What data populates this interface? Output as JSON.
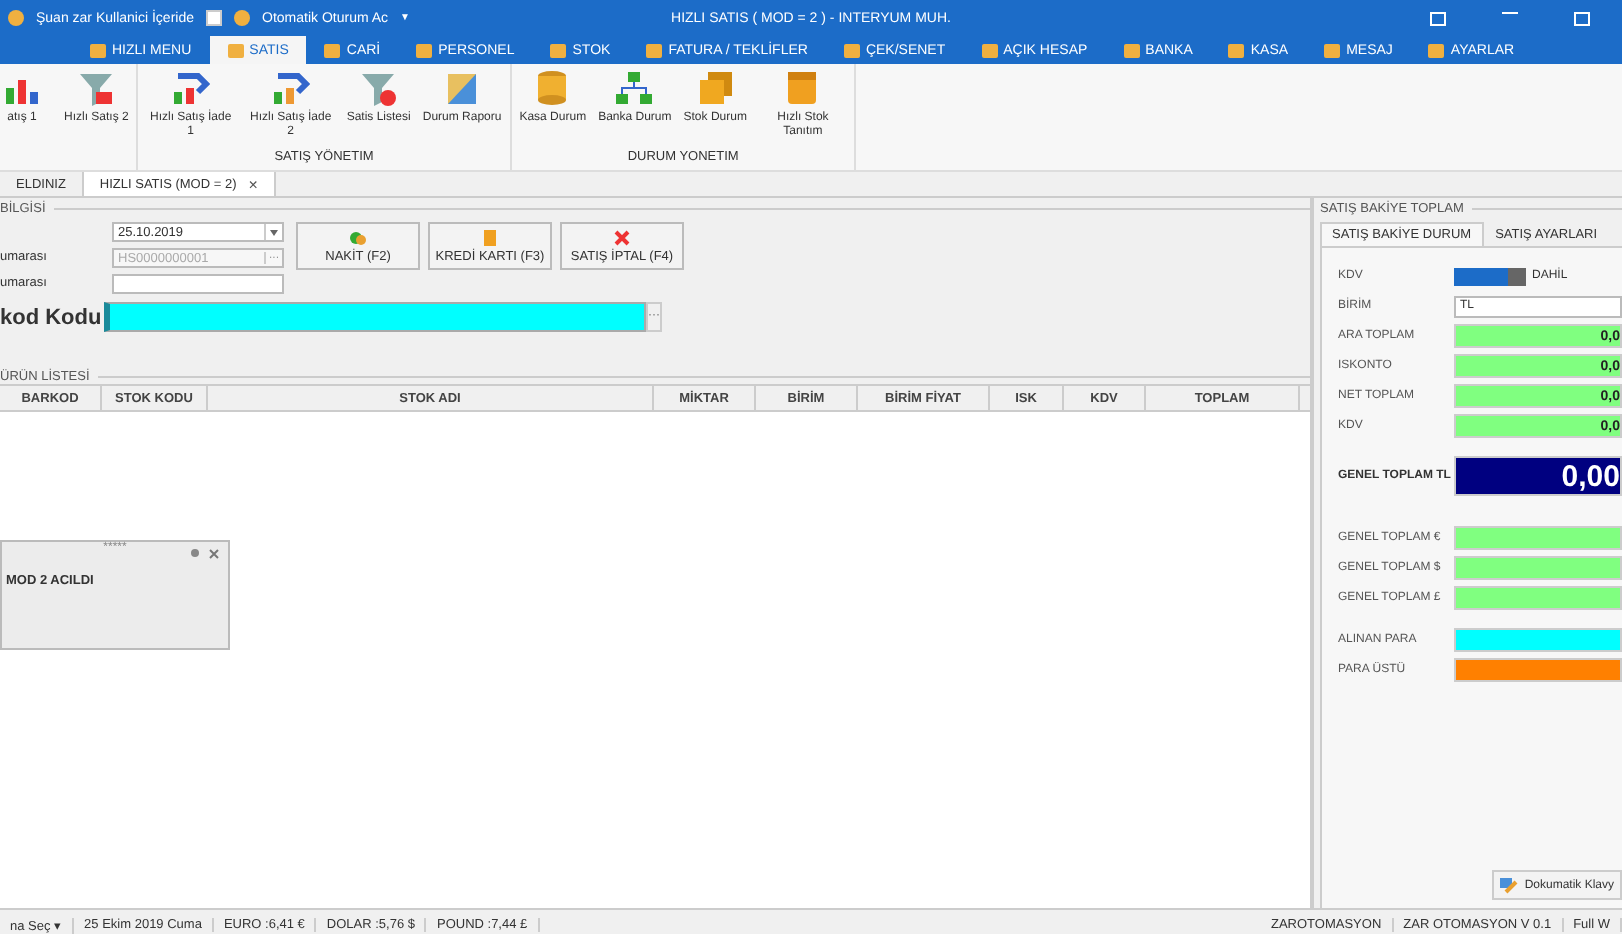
{
  "title_bar": {
    "user_status": "Şuan zar Kullanici İçeride",
    "auto_login": {
      "label": "Otomatik Oturum Ac",
      "checked": false
    },
    "dropdown": "▼",
    "title": "HIZLI SATIS ( MOD = 2 ) - INTERYUM MUH."
  },
  "menu_tabs": [
    {
      "label": "HIZLI MENU",
      "selected": false
    },
    {
      "label": "SATIS",
      "selected": true
    },
    {
      "label": "CARİ",
      "selected": false
    },
    {
      "label": "PERSONEL",
      "selected": false
    },
    {
      "label": "STOK",
      "selected": false
    },
    {
      "label": "FATURA / TEKLİFLER",
      "selected": false
    },
    {
      "label": "ÇEK/SENET",
      "selected": false
    },
    {
      "label": "AÇIK HESAP",
      "selected": false
    },
    {
      "label": "BANKA",
      "selected": false
    },
    {
      "label": "KASA",
      "selected": false
    },
    {
      "label": "MESAJ",
      "selected": false
    },
    {
      "label": "AYARLAR",
      "selected": false
    }
  ],
  "ribbon_groups": [
    {
      "items": [
        "atış 1",
        "Hızlı Satış 2"
      ]
    },
    {
      "label": "SATIŞ YÖNETIM",
      "items": [
        "Hızlı Satış İade 1",
        "Hızlı Satış İade 2",
        "Satis Listesi",
        "Durum Raporu"
      ]
    },
    {
      "label": "DURUM YONETIM",
      "items": [
        "Kasa Durum",
        "Banka Durum",
        "Stok Durum",
        "Hızlı Stok Tanıtım"
      ]
    }
  ],
  "document_tabs": [
    {
      "label": "ELDINIZ",
      "selected": false
    },
    {
      "label": "HIZLI SATIS (MOD = 2)",
      "selected": true,
      "close": "×"
    }
  ],
  "sale_info": {
    "title": "BİLGİSİ",
    "date": "25.10.2019",
    "receipt_label": "umarası",
    "receipt_number": "HS0000000001",
    "doc_label": "umarası",
    "barcode_label": "kod Kodu",
    "ellipsis": "···",
    "buttons": [
      {
        "label": "NAKİT (F2)"
      },
      {
        "label": "KREDİ KARTI (F3)"
      },
      {
        "label": "SATIŞ İPTAL (F4)"
      }
    ]
  },
  "product_list": {
    "title": "ÜRÜN LİSTESİ",
    "columns": [
      "BARKOD",
      "STOK KODU",
      "STOK ADI",
      "MİKTAR",
      "BİRİM",
      "BİRİM FİYAT",
      "ISK",
      "KDV",
      "TOPLAM"
    ]
  },
  "notification": {
    "handle": "*****",
    "message": "MOD 2 ACILDI"
  },
  "summary_panel": {
    "title": "SATIŞ BAKİYE TOPLAM",
    "tabs": [
      {
        "label": "SATIŞ BAKİYE DURUM",
        "selected": true
      },
      {
        "label": "SATIŞ AYARLARI",
        "selected": false
      }
    ],
    "rows": [
      {
        "kind": "toggle",
        "label": "KDV",
        "value": "DAHİL",
        "on": true
      },
      {
        "kind": "text",
        "label": "BİRİM",
        "value": "TL"
      },
      {
        "kind": "amount",
        "label": "ARA TOPLAM",
        "value": "0,0",
        "color": "#80ff80"
      },
      {
        "kind": "amount",
        "label": "ISKONTO",
        "value": "0,0",
        "color": "#80ff80"
      },
      {
        "kind": "amount",
        "label": "NET TOPLAM",
        "value": "0,0",
        "color": "#80ff80"
      },
      {
        "kind": "amount",
        "label": "KDV",
        "value": "0,0",
        "color": "#80ff80"
      },
      {
        "kind": "total",
        "label": "GENEL TOPLAM TL",
        "value": "0,00",
        "color": "#000080"
      },
      {
        "kind": "amount",
        "label": "GENEL TOPLAM €",
        "color": "#80ff80"
      },
      {
        "kind": "amount",
        "label": "GENEL TOPLAM $",
        "color": "#80ff80"
      },
      {
        "kind": "amount",
        "label": "GENEL TOPLAM £",
        "color": "#80ff80"
      },
      {
        "kind": "amount",
        "label": "ALINAN PARA",
        "color": "#00ffff"
      },
      {
        "kind": "amount",
        "label": "PARA ÜSTÜ",
        "color": "#ff8000"
      }
    ],
    "keyboard_button": "Dokumatik Klavy"
  },
  "status_bar": {
    "left": [
      "na Seç ▾",
      "25 Ekim 2019 Cuma",
      "EURO :6,41 €",
      "DOLAR :5,76 $",
      "POUND :7,44 £"
    ],
    "right": [
      "ZAROTOMASYON",
      "ZAR OTOMASYON V 0.1",
      "Full W"
    ]
  }
}
